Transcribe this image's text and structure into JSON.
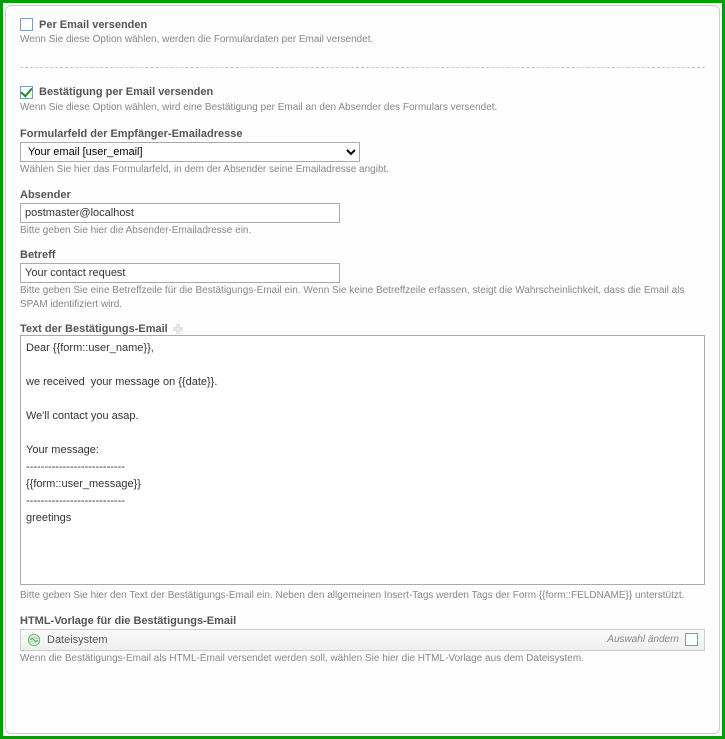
{
  "perEmail": {
    "label": "Per Email versenden",
    "help": "Wenn Sie diese Option wählen, werden die Formulardaten per Email versendet."
  },
  "confirmEmail": {
    "label": "Bestätigung per Email versenden",
    "help": "Wenn Sie diese Option wählen, wird eine Bestätigung per Email an den Absender des Formulars versendet."
  },
  "recipientField": {
    "label": "Formularfeld der Empfänger-Emailadresse",
    "value": "Your email [user_email]",
    "help": "Wählen Sie hier das Formularfeld, in dem der Absender seine Emailadresse angibt."
  },
  "sender": {
    "label": "Absender",
    "value": "postmaster@localhost",
    "help": "Bitte geben Sie hier die Absender-Emailadresse ein."
  },
  "subject": {
    "label": "Betreff",
    "value": "Your contact request",
    "help": "Bitte geben Sie eine Betreffzeile für die Bestätigungs-Email ein. Wenn Sie keine Betreffzeile erfassen, steigt die Wahrscheinlichkeit, dass die Email als SPAM identifiziert wird."
  },
  "bodyText": {
    "label": "Text der Bestätigungs-Email",
    "value": "Dear {{form::user_name}},\n\nwe received  your message on {{date}}.\n\nWe'll contact you asap.\n\nYour message:\n---------------------------\n{{form::user_message}}\n---------------------------\ngreetings",
    "help": "Bitte geben Sie hier den Text der Bestätigungs-Email ein. Neben den allgemeinen Insert-Tags werden Tags der Form {{form::FELDNAME}} unterstützt."
  },
  "htmlTemplate": {
    "label": "HTML-Vorlage für die Bestätigungs-Email",
    "source": "Dateisystem",
    "changeLink": "Auswahl ändern",
    "help": "Wenn die Bestätigungs-Email als HTML-Email versendet werden soll, wählen Sie hier die HTML-Vorlage aus dem Dateisystem."
  }
}
